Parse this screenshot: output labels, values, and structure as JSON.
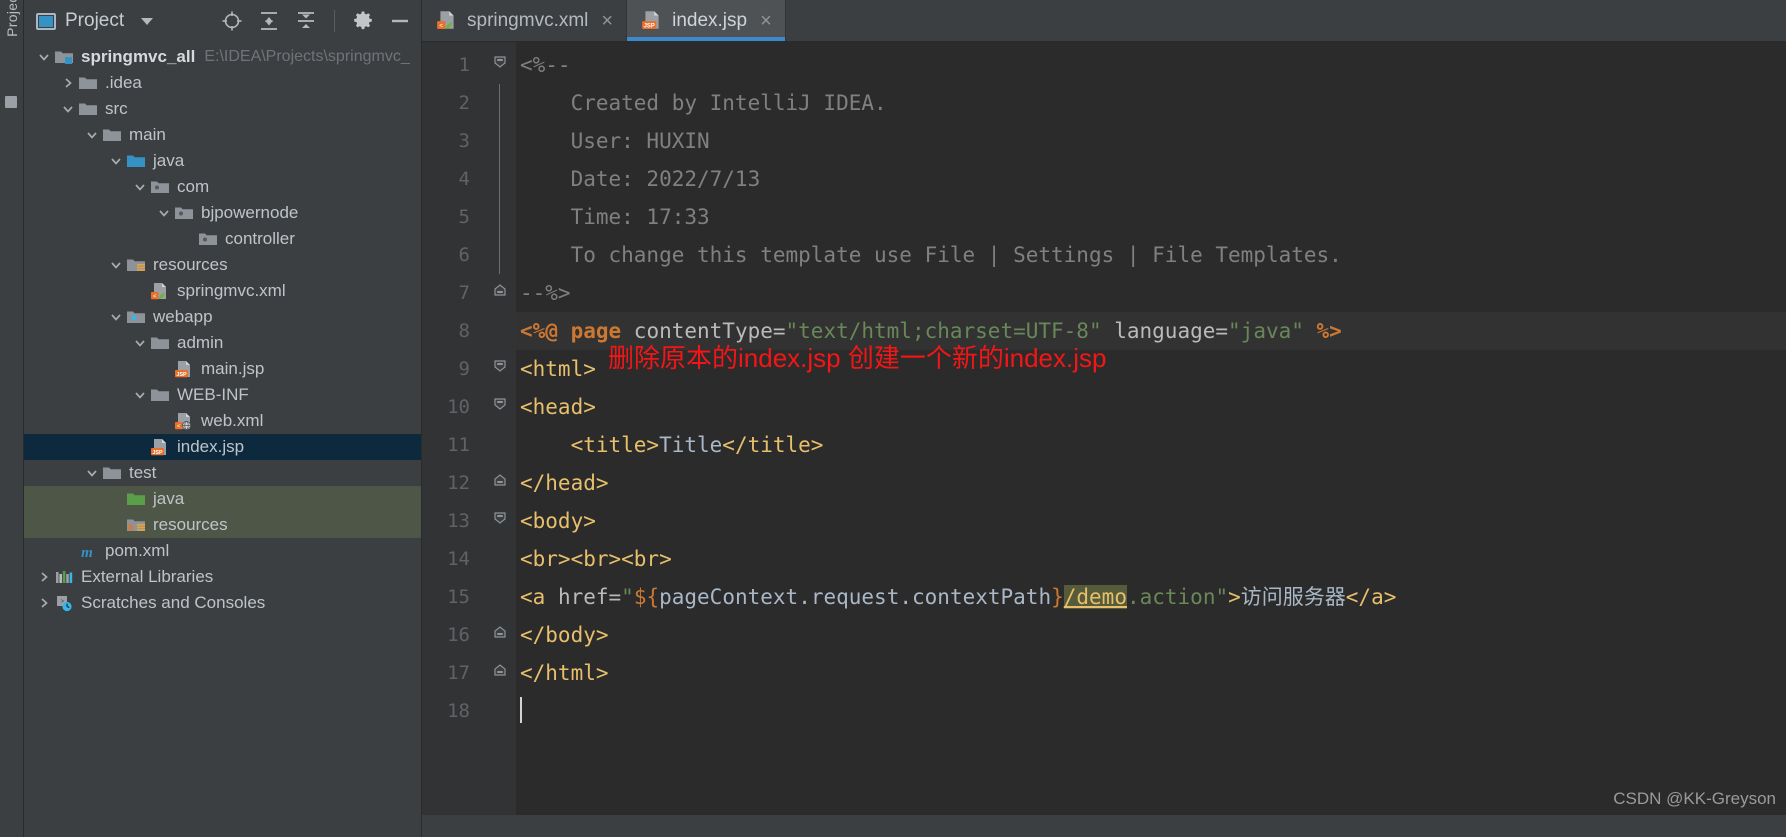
{
  "toolstrip": {
    "label": "Project"
  },
  "sidebar": {
    "title": "Project",
    "caret_icon": "chevron-down-icon",
    "actions": [
      {
        "name": "locate-target-icon",
        "label": "Select Opened File"
      },
      {
        "name": "expand-all-icon",
        "label": "Expand All"
      },
      {
        "name": "collapse-all-icon",
        "label": "Collapse All"
      },
      {
        "name": "gear-icon",
        "label": "Settings"
      },
      {
        "name": "minimize-icon",
        "label": "Hide"
      }
    ],
    "tree": [
      {
        "indent": 0,
        "arrow": "down",
        "icon": "module-folder-icon",
        "label": "springmvc_all",
        "bold": true,
        "path": "E:\\IDEA\\Projects\\springmvc_",
        "state": "normal"
      },
      {
        "indent": 1,
        "arrow": "right",
        "icon": "folder-icon",
        "label": ".idea",
        "bold": false,
        "path": "",
        "state": "normal"
      },
      {
        "indent": 1,
        "arrow": "down",
        "icon": "folder-icon",
        "label": "src",
        "bold": false,
        "path": "",
        "state": "normal"
      },
      {
        "indent": 2,
        "arrow": "down",
        "icon": "folder-icon",
        "label": "main",
        "bold": false,
        "path": "",
        "state": "normal"
      },
      {
        "indent": 3,
        "arrow": "down",
        "icon": "source-root-icon",
        "label": "java",
        "bold": false,
        "path": "",
        "state": "normal"
      },
      {
        "indent": 4,
        "arrow": "down",
        "icon": "package-icon",
        "label": "com",
        "bold": false,
        "path": "",
        "state": "normal"
      },
      {
        "indent": 5,
        "arrow": "down",
        "icon": "package-icon",
        "label": "bjpowernode",
        "bold": false,
        "path": "",
        "state": "normal"
      },
      {
        "indent": 6,
        "arrow": "none",
        "icon": "package-icon",
        "label": "controller",
        "bold": false,
        "path": "",
        "state": "normal"
      },
      {
        "indent": 3,
        "arrow": "down",
        "icon": "resource-root-icon",
        "label": "resources",
        "bold": false,
        "path": "",
        "state": "normal"
      },
      {
        "indent": 4,
        "arrow": "none",
        "icon": "spring-xml-icon",
        "label": "springmvc.xml",
        "bold": false,
        "path": "",
        "state": "normal"
      },
      {
        "indent": 3,
        "arrow": "down",
        "icon": "webapp-folder-icon",
        "label": "webapp",
        "bold": false,
        "path": "",
        "state": "normal"
      },
      {
        "indent": 4,
        "arrow": "down",
        "icon": "folder-icon",
        "label": "admin",
        "bold": false,
        "path": "",
        "state": "normal"
      },
      {
        "indent": 5,
        "arrow": "none",
        "icon": "jsp-file-icon",
        "label": "main.jsp",
        "bold": false,
        "path": "",
        "state": "normal"
      },
      {
        "indent": 4,
        "arrow": "down",
        "icon": "folder-icon",
        "label": "WEB-INF",
        "bold": false,
        "path": "",
        "state": "normal"
      },
      {
        "indent": 5,
        "arrow": "none",
        "icon": "web-xml-icon",
        "label": "web.xml",
        "bold": false,
        "path": "",
        "state": "normal"
      },
      {
        "indent": 4,
        "arrow": "none",
        "icon": "jsp-file-icon",
        "label": "index.jsp",
        "bold": false,
        "path": "",
        "state": "selected"
      },
      {
        "indent": 2,
        "arrow": "down",
        "icon": "folder-icon",
        "label": "test",
        "bold": false,
        "path": "",
        "state": "normal"
      },
      {
        "indent": 3,
        "arrow": "none",
        "icon": "test-source-icon",
        "label": "java",
        "bold": false,
        "path": "",
        "state": "testsrc"
      },
      {
        "indent": 3,
        "arrow": "none",
        "icon": "test-resource-icon",
        "label": "resources",
        "bold": false,
        "path": "",
        "state": "testsrc"
      },
      {
        "indent": 1,
        "arrow": "none",
        "icon": "maven-icon",
        "label": "pom.xml",
        "bold": false,
        "path": "",
        "state": "normal"
      },
      {
        "indent": 0,
        "arrow": "right",
        "icon": "libraries-icon",
        "label": "External Libraries",
        "bold": false,
        "path": "",
        "state": "normal"
      },
      {
        "indent": 0,
        "arrow": "right",
        "icon": "scratches-icon",
        "label": "Scratches and Consoles",
        "bold": false,
        "path": "",
        "state": "normal"
      }
    ]
  },
  "editor": {
    "tabs": [
      {
        "label": "springmvc.xml",
        "icon": "spring-xml-icon",
        "active": false,
        "close_glyph": "×"
      },
      {
        "label": "index.jsp",
        "icon": "jsp-file-icon",
        "active": true,
        "close_glyph": "×"
      }
    ],
    "line_numbers": [
      "1",
      "2",
      "3",
      "4",
      "5",
      "6",
      "7",
      "8",
      "9",
      "10",
      "11",
      "12",
      "13",
      "14",
      "15",
      "16",
      "17",
      "18"
    ],
    "lines": [
      {
        "n": 1,
        "fold": "start",
        "tokens": [
          {
            "t": "<%--",
            "c": "c-comment"
          }
        ]
      },
      {
        "n": 2,
        "fold": "bar",
        "tokens": [
          {
            "t": "    Created by IntelliJ IDEA.",
            "c": "c-comment"
          }
        ]
      },
      {
        "n": 3,
        "fold": "bar",
        "tokens": [
          {
            "t": "    User: HUXIN",
            "c": "c-comment"
          }
        ]
      },
      {
        "n": 4,
        "fold": "bar",
        "tokens": [
          {
            "t": "    Date: 2022/7/13",
            "c": "c-comment"
          }
        ]
      },
      {
        "n": 5,
        "fold": "bar",
        "tokens": [
          {
            "t": "    Time: 17:33",
            "c": "c-comment"
          }
        ]
      },
      {
        "n": 6,
        "fold": "bar",
        "tokens": [
          {
            "t": "    To change this template use File | Settings | File Templates.",
            "c": "c-comment"
          }
        ]
      },
      {
        "n": 7,
        "fold": "end",
        "tokens": [
          {
            "t": "--%>",
            "c": "c-comment"
          }
        ]
      },
      {
        "n": 8,
        "fold": "none",
        "current": true,
        "tokens": [
          {
            "t": "<%@ ",
            "c": "c-kw"
          },
          {
            "t": "page ",
            "c": "c-kw"
          },
          {
            "t": "contentType=",
            "c": "c-attr"
          },
          {
            "t": "\"text/html;charset=UTF-8\"",
            "c": "c-str"
          },
          {
            "t": " language=",
            "c": "c-attr"
          },
          {
            "t": "\"java\"",
            "c": "c-str"
          },
          {
            "t": " %>",
            "c": "c-kw"
          }
        ]
      },
      {
        "n": 9,
        "fold": "start",
        "tokens": [
          {
            "t": "<html>",
            "c": "c-tag"
          }
        ]
      },
      {
        "n": 10,
        "fold": "start",
        "tokens": [
          {
            "t": "<head>",
            "c": "c-tag"
          }
        ]
      },
      {
        "n": 11,
        "fold": "none",
        "tokens": [
          {
            "t": "    <title>",
            "c": "c-tag"
          },
          {
            "t": "Title",
            "c": "c-text"
          },
          {
            "t": "</title>",
            "c": "c-tag"
          }
        ]
      },
      {
        "n": 12,
        "fold": "end",
        "tokens": [
          {
            "t": "</head>",
            "c": "c-tag"
          }
        ]
      },
      {
        "n": 13,
        "fold": "start",
        "tokens": [
          {
            "t": "<body>",
            "c": "c-tag"
          }
        ]
      },
      {
        "n": 14,
        "fold": "none",
        "tokens": [
          {
            "t": "<br><br><br>",
            "c": "c-tag"
          }
        ]
      },
      {
        "n": 15,
        "fold": "none",
        "tokens": [
          {
            "t": "<a ",
            "c": "c-tag"
          },
          {
            "t": "href=",
            "c": "c-attr"
          },
          {
            "t": "\"",
            "c": "c-str"
          },
          {
            "t": "${",
            "c": "c-el"
          },
          {
            "t": "pageContext",
            "c": "c-plain"
          },
          {
            "t": ".",
            "c": "c-plain"
          },
          {
            "t": "request",
            "c": "c-plain"
          },
          {
            "t": ".",
            "c": "c-plain"
          },
          {
            "t": "contextPath",
            "c": "c-plain"
          },
          {
            "t": "}",
            "c": "c-el"
          },
          {
            "t": "/demo",
            "c": "c-link"
          },
          {
            "t": ".action\"",
            "c": "c-str"
          },
          {
            "t": ">",
            "c": "c-tag"
          },
          {
            "t": "访问服务器",
            "c": "c-text"
          },
          {
            "t": "</a>",
            "c": "c-tag"
          }
        ]
      },
      {
        "n": 16,
        "fold": "end",
        "tokens": [
          {
            "t": "</body>",
            "c": "c-tag"
          }
        ]
      },
      {
        "n": 17,
        "fold": "end",
        "tokens": [
          {
            "t": "</html>",
            "c": "c-tag"
          }
        ]
      },
      {
        "n": 18,
        "fold": "none",
        "caret": true,
        "tokens": []
      }
    ],
    "annotation": "删除原本的index.jsp 创建一个新的index.jsp",
    "annotation_color": "#f41616"
  },
  "watermark": "CSDN @KK-Greyson",
  "colors": {
    "panel_bg": "#3c3f41",
    "editor_bg": "#2b2b2b",
    "gutter_bg": "#313335",
    "selection_blue": "#0d293e",
    "test_source_green": "#4e5647",
    "tab_active_underline": "#3d89d0",
    "tag_yellow": "#e8bf6a",
    "string_green": "#6a8759",
    "keyword_orange": "#cc7832",
    "comment_gray": "#808080"
  }
}
